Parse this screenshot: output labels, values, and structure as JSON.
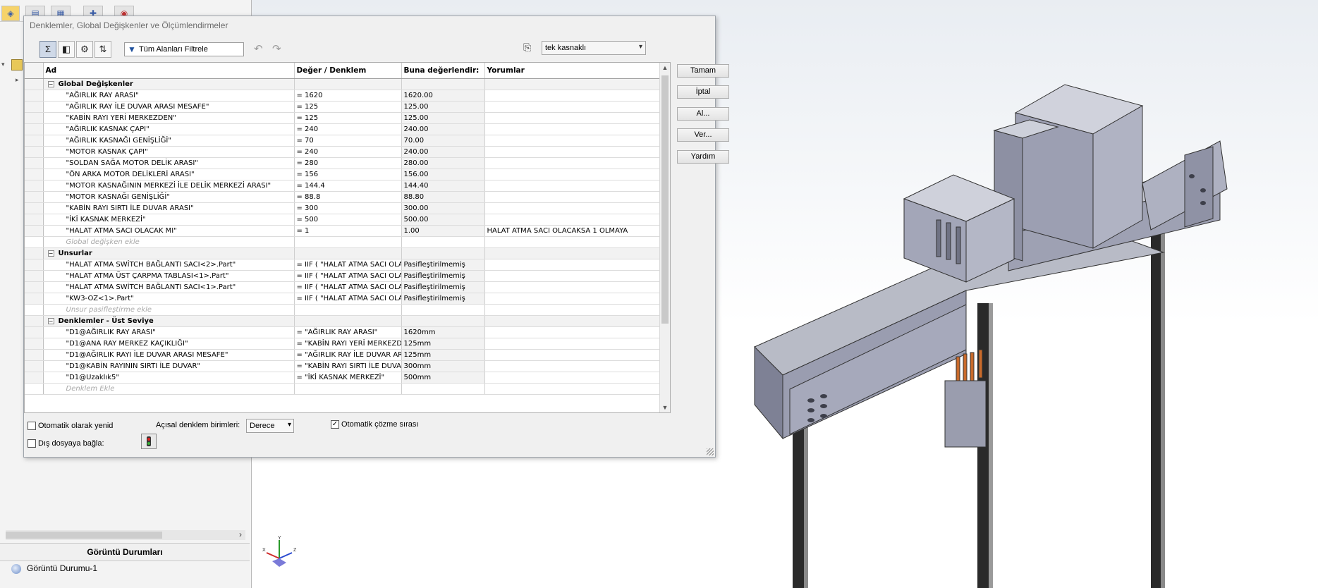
{
  "left_panel": {
    "display_states_header": "Görüntü Durumları",
    "display_state_item": "Görüntü Durumu-1"
  },
  "dialog": {
    "title": "Denklemler, Global Değişkenler ve Ölçümlendirmeler",
    "filter_placeholder": "Tüm Alanları Filtrele",
    "configuration": "tek kasnaklı",
    "buttons": {
      "ok": "Tamam",
      "cancel": "İptal",
      "open": "Al...",
      "export": "Ver...",
      "help": "Yardım"
    },
    "table": {
      "headers": [
        "Ad",
        "Değer / Denklem",
        "Buna değerlendir:",
        "Yorumlar"
      ],
      "groups": [
        {
          "title": "Global Değişkenler",
          "rows": [
            {
              "name": "\"AĞIRLIK RAY ARASI\"",
              "value": "= 1620",
              "result": "1620.00",
              "comment": ""
            },
            {
              "name": "\"AĞIRLIK RAY İLE DUVAR ARASI MESAFE\"",
              "value": "= 125",
              "result": "125.00",
              "comment": ""
            },
            {
              "name": "\"KABİN RAYI YERİ MERKEZDEN\"",
              "value": "= 125",
              "result": "125.00",
              "comment": ""
            },
            {
              "name": "\"AĞIRLIK KASNAK ÇAPI\"",
              "value": "= 240",
              "result": "240.00",
              "comment": ""
            },
            {
              "name": "\"AĞIRLIK KASNAĞI GENİŞLİĞİ\"",
              "value": "= 70",
              "result": "70.00",
              "comment": ""
            },
            {
              "name": "\"MOTOR KASNAK ÇAPI\"",
              "value": "= 240",
              "result": "240.00",
              "comment": ""
            },
            {
              "name": "\"SOLDAN SAĞA MOTOR DELİK ARASI\"",
              "value": "= 280",
              "result": "280.00",
              "comment": ""
            },
            {
              "name": "\"ÖN ARKA MOTOR DELİKLERİ ARASI\"",
              "value": "= 156",
              "result": "156.00",
              "comment": ""
            },
            {
              "name": "\"MOTOR KASNAĞININ MERKEZİ İLE DELİK MERKEZİ ARASI\"",
              "value": "= 144.4",
              "result": "144.40",
              "comment": ""
            },
            {
              "name": "\"MOTOR KASNAĞI GENİŞLİĞİ\"",
              "value": "= 88.8",
              "result": "88.80",
              "comment": ""
            },
            {
              "name": "\"KABİN RAYI SIRTI İLE DUVAR ARASI\"",
              "value": "= 300",
              "result": "300.00",
              "comment": ""
            },
            {
              "name": "\"İKİ KASNAK MERKEZİ\"",
              "value": "= 500",
              "result": "500.00",
              "comment": ""
            },
            {
              "name": "\"HALAT ATMA SACI OLACAK MI\"",
              "value": "= 1",
              "result": "1.00",
              "comment": "HALAT ATMA SACI OLACAKSA 1 OLMAYA"
            }
          ],
          "add_label": "Global değişken ekle"
        },
        {
          "title": "Unsurlar",
          "rows": [
            {
              "name": "\"HALAT ATMA SWİTCH BAĞLANTI SACI<2>.Part\"",
              "value": "= IIF ( \"HALAT ATMA SACI OLA",
              "result": "Pasifleştirilmemiş",
              "comment": ""
            },
            {
              "name": "\"HALAT ATMA ÜST ÇARPMA TABLASI<1>.Part\"",
              "value": "= IIF ( \"HALAT ATMA SACI OLA",
              "result": "Pasifleştirilmemiş",
              "comment": ""
            },
            {
              "name": "\"HALAT ATMA SWİTCH BAĞLANTI SACI<1>.Part\"",
              "value": "= IIF ( \"HALAT ATMA SACI OLA",
              "result": "Pasifleştirilmemiş",
              "comment": ""
            },
            {
              "name": "\"KW3-OZ<1>.Part\"",
              "value": "= IIF ( \"HALAT ATMA SACI OLA",
              "result": "Pasifleştirilmemiş",
              "comment": ""
            }
          ],
          "add_label": "Unsur pasifleştirme ekle"
        },
        {
          "title": "Denklemler - Üst Seviye",
          "rows": [
            {
              "name": "\"D1@AĞIRLIK RAY ARASI\"",
              "value": "= \"AĞIRLIK RAY ARASI\"",
              "result": "1620mm",
              "comment": ""
            },
            {
              "name": "\"D1@ANA RAY MERKEZ KAÇIKLIĞI\"",
              "value": "= \"KABİN RAYI YERİ MERKEZDE",
              "result": "125mm",
              "comment": ""
            },
            {
              "name": "\"D1@AĞIRLIK RAYI İLE DUVAR ARASI MESAFE\"",
              "value": "= \"AĞIRLIK RAY İLE DUVAR AR",
              "result": "125mm",
              "comment": ""
            },
            {
              "name": "\"D1@KABİN RAYININ SIRTI İLE DUVAR\"",
              "value": "= \"KABİN RAYI SIRTI İLE DUVAR",
              "result": "300mm",
              "comment": ""
            },
            {
              "name": "\"D1@Uzaklık5\"",
              "value": "= \"İKİ KASNAK MERKEZİ\"",
              "result": "500mm",
              "comment": ""
            }
          ],
          "add_label": "Denklem Ekle"
        }
      ]
    },
    "bottom": {
      "auto_rebuild": "Otomatik olarak yenid",
      "angular_units_label": "Açısal denklem birimleri:",
      "angular_units_value": "Derece",
      "auto_solve": "Otomatik çözme sırası",
      "link_external": "Dış dosyaya bağla:"
    }
  },
  "triad": {
    "x": "X",
    "y": "Y",
    "z": "Z"
  }
}
